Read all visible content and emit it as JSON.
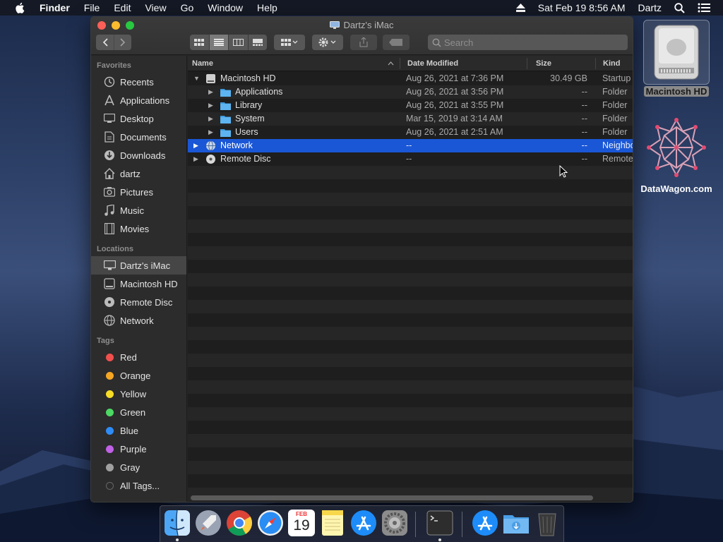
{
  "menubar": {
    "app": "Finder",
    "items": [
      "File",
      "Edit",
      "View",
      "Go",
      "Window",
      "Help"
    ],
    "datetime": "Sat Feb 19  8:56 AM",
    "user": "Dartz"
  },
  "window": {
    "title": "Dartz's iMac",
    "search_placeholder": "Search"
  },
  "sidebar": {
    "favorites_header": "Favorites",
    "favorites": [
      {
        "label": "Recents",
        "icon": "recents-icon"
      },
      {
        "label": "Applications",
        "icon": "applications-icon"
      },
      {
        "label": "Desktop",
        "icon": "desktop-icon"
      },
      {
        "label": "Documents",
        "icon": "documents-icon"
      },
      {
        "label": "Downloads",
        "icon": "downloads-icon"
      },
      {
        "label": "dartz",
        "icon": "home-icon"
      },
      {
        "label": "Pictures",
        "icon": "pictures-icon"
      },
      {
        "label": "Music",
        "icon": "music-icon"
      },
      {
        "label": "Movies",
        "icon": "movies-icon"
      }
    ],
    "locations_header": "Locations",
    "locations": [
      {
        "label": "Dartz's iMac",
        "icon": "imac-icon"
      },
      {
        "label": "Macintosh HD",
        "icon": "hard-drive-icon"
      },
      {
        "label": "Remote Disc",
        "icon": "disc-icon"
      },
      {
        "label": "Network",
        "icon": "network-icon"
      }
    ],
    "tags_header": "Tags",
    "tags": [
      {
        "label": "Red",
        "color": "#f0504d"
      },
      {
        "label": "Orange",
        "color": "#f5a623"
      },
      {
        "label": "Yellow",
        "color": "#f7dd26"
      },
      {
        "label": "Green",
        "color": "#4cd964"
      },
      {
        "label": "Blue",
        "color": "#2f8cf6"
      },
      {
        "label": "Purple",
        "color": "#c061e6"
      },
      {
        "label": "Gray",
        "color": "#a0a0a0"
      },
      {
        "label": "All Tags...",
        "color": "#555555"
      }
    ]
  },
  "columns": {
    "name": "Name",
    "date": "Date Modified",
    "size": "Size",
    "kind": "Kind"
  },
  "rows": [
    {
      "name": "Macintosh HD",
      "date": "Aug 26, 2021 at 7:36 PM",
      "size": "30.49 GB",
      "kind": "Startup",
      "expanded": true
    },
    {
      "name": "Applications",
      "date": "Aug 26, 2021 at 3:56 PM",
      "size": "--",
      "kind": "Folder"
    },
    {
      "name": "Library",
      "date": "Aug 26, 2021 at 3:55 PM",
      "size": "--",
      "kind": "Folder"
    },
    {
      "name": "System",
      "date": "Mar 15, 2019 at 3:14 AM",
      "size": "--",
      "kind": "Folder"
    },
    {
      "name": "Users",
      "date": "Aug 26, 2021 at 2:51 AM",
      "size": "--",
      "kind": "Folder"
    },
    {
      "name": "Network",
      "date": "--",
      "size": "--",
      "kind": "Neighbo",
      "selected": true
    },
    {
      "name": "Remote Disc",
      "date": "--",
      "size": "--",
      "kind": "Remote"
    }
  ],
  "desktop": {
    "hd_label": "Macintosh HD",
    "logo_label": "DataWagon.com"
  },
  "dock": {
    "calendar_month": "FEB",
    "calendar_day": "19"
  }
}
